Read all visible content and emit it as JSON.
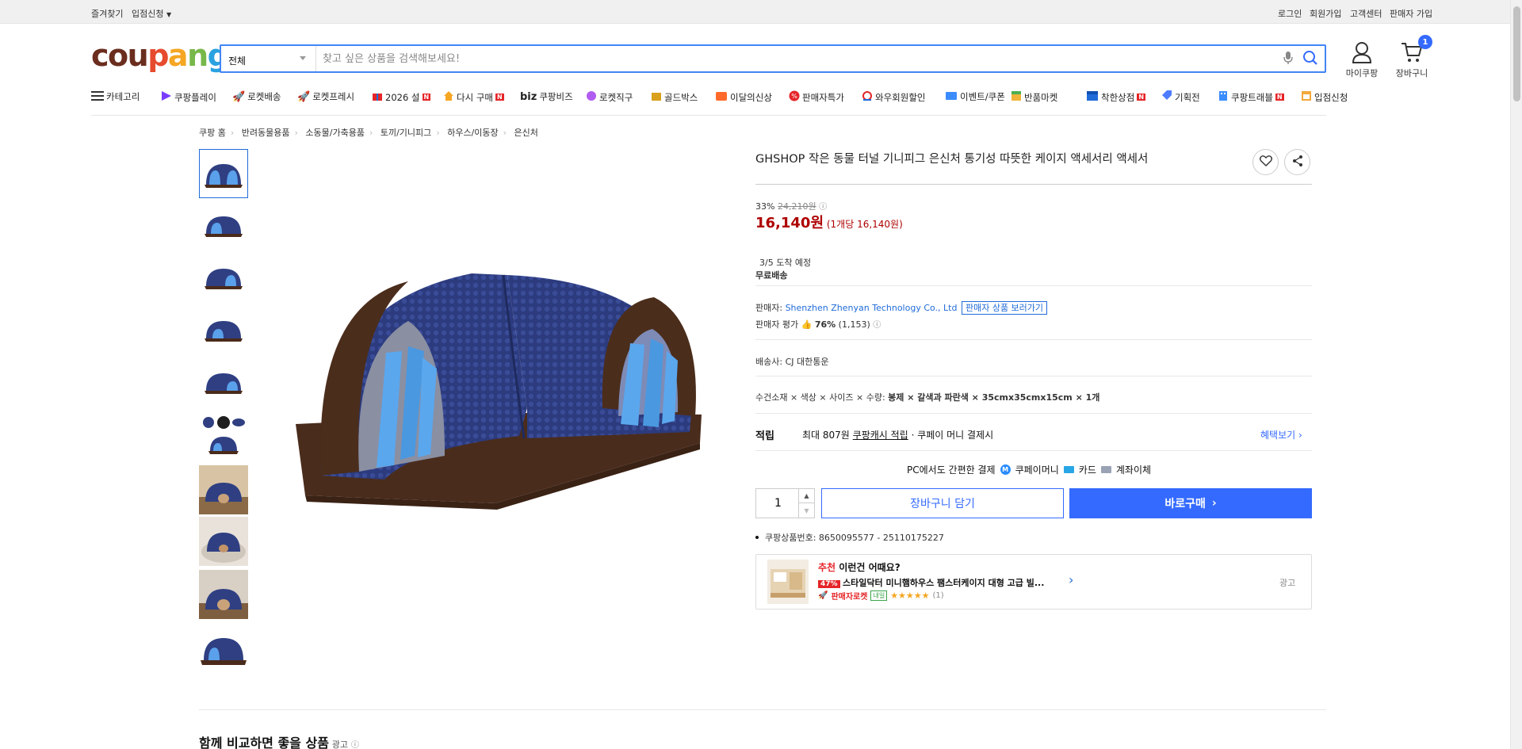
{
  "topbar": {
    "left": [
      "즐겨찾기",
      "입점신청"
    ],
    "right": [
      "로그인",
      "회원가입",
      "고객센터",
      "판매자 가입"
    ]
  },
  "logo": {
    "letters": [
      "c",
      "o",
      "u",
      "p",
      "a",
      "n",
      "g"
    ],
    "colors": [
      "#6b2d1e",
      "#6b2d1e",
      "#6b2d1e",
      "#e64b2e",
      "#f5a623",
      "#77b84a",
      "#2aa1e0"
    ]
  },
  "search": {
    "category": "전체",
    "placeholder": "찾고 싶은 상품을 검색해보세요!"
  },
  "header_icons": {
    "mycoupang": "마이쿠팡",
    "cart": "장바구니",
    "cart_count": "1"
  },
  "catnav": [
    "카테고리",
    "쿠팡플레이",
    "로켓배송",
    "로켓프레시",
    "2026 설",
    "다시 구매",
    "쿠팡비즈",
    "로켓직구",
    "골드박스",
    "이달의신상",
    "판매자특가",
    "와우회원할인",
    "이벤트/쿠폰",
    "반품마켓",
    "착한상점",
    "기획전",
    "쿠팡트래블",
    "입점신청"
  ],
  "catnav_biz_prefix": "biz",
  "catnav_new_badge": "N",
  "breadcrumb": [
    "쿠팡 홈",
    "반려동물용품",
    "소동물/가축용품",
    "토끼/기니피그",
    "하우스/이동장",
    "은신처"
  ],
  "product": {
    "title": "GHSHOP 작은 동물 터널 기니피그 은신처 통기성 따뜻한 케이지 액세서리 액세서",
    "discount": "33%",
    "original_price": "24,210원",
    "price": "16,140원",
    "unit_price": "(1개당 16,140원)",
    "arrival": "3/5 도착 예정",
    "shipping": "무료배송",
    "seller_label": "판매자:",
    "seller_name": "Shenzhen Zhenyan Technology Co., Ltd",
    "seller_link": "판매자 상품 보러가기",
    "seller_rating_label": "판매자 평가",
    "seller_rating": "76%",
    "seller_rating_count": "(1,153)",
    "carrier_label": "배송사:",
    "carrier": "CJ 대한통운",
    "option_label": "수건소재 × 색상 × 사이즈 × 수량:",
    "option_value": "봉제 × 갈색과 파란색 × 35cmx35cmx15cm × 1개",
    "reward_label": "적립",
    "reward_text_1": "최대 807원",
    "reward_link": "쿠팡캐시 적립",
    "reward_text_2": "· 쿠페이 머니 결제시",
    "benefit_link": "혜택보기",
    "payment_intro": "PC에서도 간편한 결제",
    "payment_methods": [
      "쿠페이머니",
      "카드",
      "계좌이체"
    ],
    "quantity": "1",
    "cart_button": "장바구니 담기",
    "buy_button": "바로구매",
    "product_number": "쿠팡상품번호: 8650095577 - 25110175227"
  },
  "reco": {
    "highlight": "추천",
    "heading": "이런건 어때요?",
    "discount": "47%",
    "item": "스타일닥터 미니햄하우스 팸스터케이지 대형 고급 빌...",
    "rocket": "판매자로켓",
    "badge": "내일",
    "stars": "★★★★★",
    "review_count": "(1)",
    "ad": "광고"
  },
  "bottom": {
    "title": "함께 비교하면 좋을 상품",
    "ad": "광고"
  },
  "colors": {
    "accent": "#346aff",
    "price_red": "#ae0000",
    "badge_red": "#e52528",
    "link": "#1f6bd8"
  }
}
